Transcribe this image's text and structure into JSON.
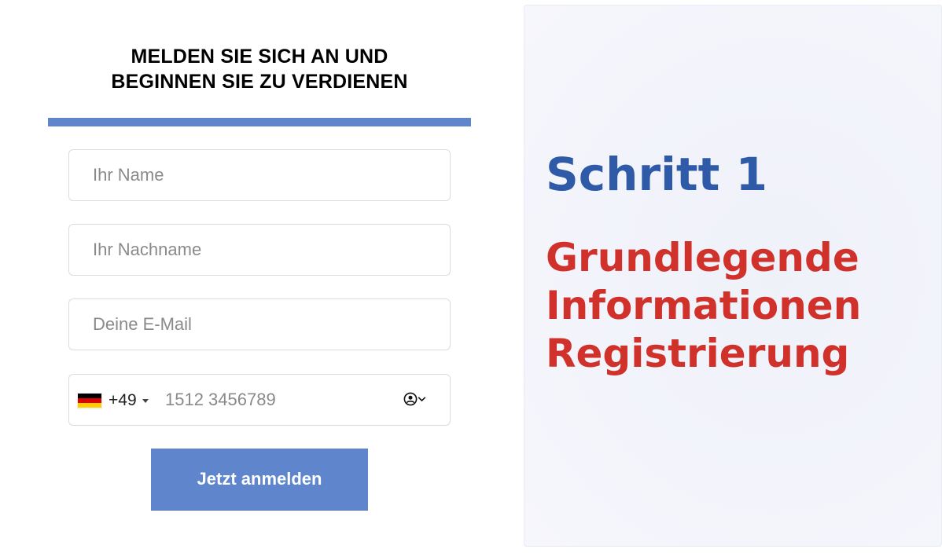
{
  "form": {
    "title_line1": "MELDEN SIE SICH AN UND",
    "title_line2": "BEGINNEN SIE ZU VERDIENEN",
    "fields": {
      "first_name_placeholder": "Ihr Name",
      "last_name_placeholder": "Ihr Nachname",
      "email_placeholder": "Deine E-Mail",
      "phone_placeholder": "1512 3456789"
    },
    "phone": {
      "country_flag": "germany-flag-icon",
      "dial_code": "+49"
    },
    "submit_label": "Jetzt anmelden"
  },
  "info": {
    "step_title": "Schritt 1",
    "description_lines": [
      "Grundlegende",
      "Informationen",
      "Registrierung"
    ]
  },
  "colors": {
    "accent_blue": "#5f86cc",
    "step_title_blue": "#2e5aa7",
    "description_red": "#d1312b"
  }
}
